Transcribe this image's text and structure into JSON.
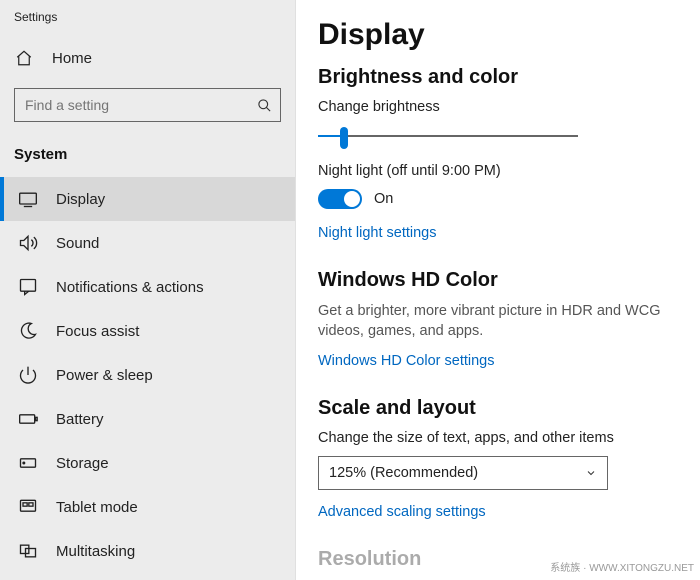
{
  "app_title": "Settings",
  "home_label": "Home",
  "search_placeholder": "Find a setting",
  "section_label": "System",
  "nav": [
    {
      "id": "display",
      "label": "Display",
      "selected": true
    },
    {
      "id": "sound",
      "label": "Sound",
      "selected": false
    },
    {
      "id": "notifications",
      "label": "Notifications & actions",
      "selected": false
    },
    {
      "id": "focus",
      "label": "Focus assist",
      "selected": false
    },
    {
      "id": "power",
      "label": "Power & sleep",
      "selected": false
    },
    {
      "id": "battery",
      "label": "Battery",
      "selected": false
    },
    {
      "id": "storage",
      "label": "Storage",
      "selected": false
    },
    {
      "id": "tablet",
      "label": "Tablet mode",
      "selected": false
    },
    {
      "id": "multitasking",
      "label": "Multitasking",
      "selected": false
    }
  ],
  "page": {
    "title": "Display",
    "brightness": {
      "heading": "Brightness and color",
      "label": "Change brightness",
      "value_percent": 10,
      "night_light_label": "Night light (off until 9:00 PM)",
      "toggle_state": "On",
      "link": "Night light settings"
    },
    "hd_color": {
      "heading": "Windows HD Color",
      "desc": "Get a brighter, more vibrant picture in HDR and WCG videos, games, and apps.",
      "link": "Windows HD Color settings"
    },
    "scale": {
      "heading": "Scale and layout",
      "label": "Change the size of text, apps, and other items",
      "value": "125% (Recommended)",
      "link": "Advanced scaling settings"
    },
    "resolution": {
      "heading": "Resolution"
    }
  },
  "watermark": {
    "brand": "系统族",
    "url": "WWW.XITONGZU.NET"
  }
}
